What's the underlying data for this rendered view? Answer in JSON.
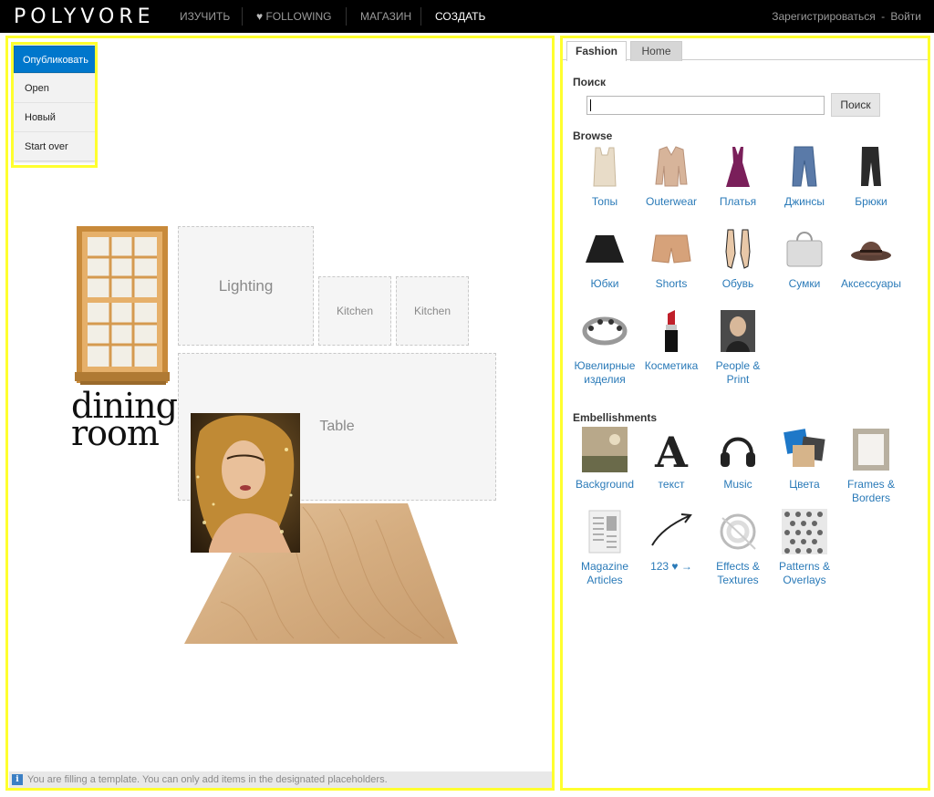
{
  "topbar": {
    "logo": "POLYVORE",
    "nav": [
      {
        "label": "ИЗУЧИТЬ"
      },
      {
        "label": "FOLLOWING"
      },
      {
        "label": "МАГАЗИН"
      },
      {
        "label": "СОЗДАТЬ"
      }
    ],
    "register": "Зарегистрироваться",
    "separator": "-",
    "login": "Войти"
  },
  "editor_menu": {
    "publish": "Опубликовать",
    "items": [
      "Open",
      "Новый",
      "Start over"
    ]
  },
  "canvas": {
    "placeholders": {
      "lighting": "Lighting",
      "kitchen_1": "Kitchen",
      "kitchen_2": "Kitchen",
      "table": "Table"
    },
    "dining_line1": "dining",
    "dining_line2": "room",
    "status": "You are filling a template. You can only add items in the designated placeholders."
  },
  "panel": {
    "tabs": [
      "Fashion",
      "Home"
    ],
    "search_title": "Поиск",
    "search_button": "Поиск",
    "browse_title": "Browse",
    "browse": [
      {
        "label": "Топы",
        "icon": "top-icon"
      },
      {
        "label": "Outerwear",
        "icon": "jacket-icon"
      },
      {
        "label": "Платья",
        "icon": "dress-icon"
      },
      {
        "label": "Джинсы",
        "icon": "jeans-icon"
      },
      {
        "label": "Брюки",
        "icon": "pants-icon"
      },
      {
        "label": "Юбки",
        "icon": "skirt-icon"
      },
      {
        "label": "Shorts",
        "icon": "shorts-icon"
      },
      {
        "label": "Обувь",
        "icon": "shoes-icon"
      },
      {
        "label": "Сумки",
        "icon": "bag-icon"
      },
      {
        "label": "Аксессуары",
        "icon": "hat-icon"
      },
      {
        "label": "Ювелирные изделия",
        "icon": "bracelet-icon"
      },
      {
        "label": "Косметика",
        "icon": "lipstick-icon"
      },
      {
        "label": "People & Print",
        "icon": "portrait-icon"
      }
    ],
    "embellish_title": "Embellishments",
    "embellishments": [
      {
        "label": "Background",
        "icon": "landscape-icon"
      },
      {
        "label": "текст",
        "icon": "letter-icon"
      },
      {
        "label": "Music",
        "icon": "headphones-icon"
      },
      {
        "label": "Цвета",
        "icon": "swatches-icon"
      },
      {
        "label": "Frames & Borders",
        "icon": "frame-icon"
      },
      {
        "label": "Magazine Articles",
        "icon": "magazine-icon"
      },
      {
        "label": "123 ♥ →",
        "icon": "arrow-icon"
      },
      {
        "label": "Effects & Textures",
        "icon": "effects-icon"
      },
      {
        "label": "Patterns & Overlays",
        "icon": "pattern-icon"
      }
    ]
  }
}
